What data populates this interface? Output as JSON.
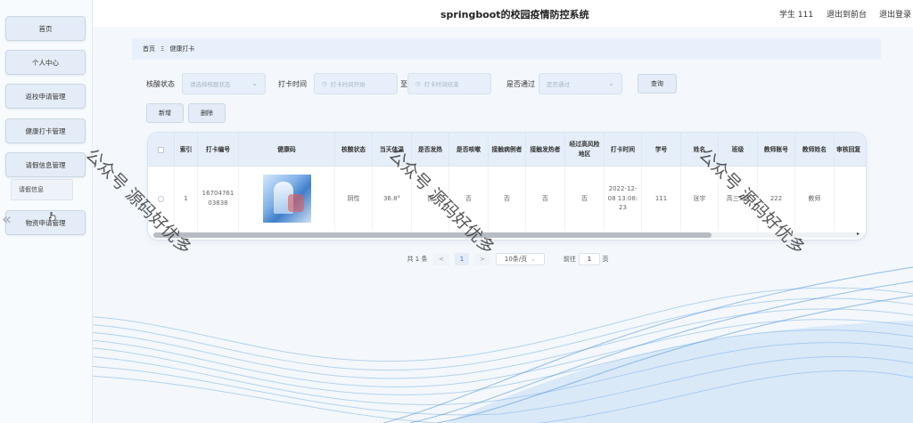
{
  "app": {
    "title": "springboot的校园疫情防控系统"
  },
  "header": {
    "user": "学生 111",
    "back_label": "退出到前台",
    "logout_label": "退出登录"
  },
  "sidebar": {
    "items": [
      {
        "label": "首页"
      },
      {
        "label": "个人中心"
      },
      {
        "label": "返校申请管理"
      },
      {
        "label": "健康打卡管理"
      },
      {
        "label": "请假信息管理"
      },
      {
        "label": "物资申请管理"
      }
    ],
    "submenu_label": "请假信息"
  },
  "breadcrumb": {
    "home": "首页",
    "sep": "Ξ",
    "current": "健康打卡"
  },
  "filters": {
    "status_label": "核酸状态",
    "status_placeholder": "请选择核酸状态",
    "time_label": "打卡时间",
    "time_start_placeholder": "打卡时间开始",
    "time_to": "至",
    "time_end_placeholder": "打卡时间结束",
    "pass_label": "是否通过",
    "pass_placeholder": "是否通过",
    "search_label": "查询",
    "add_label": "新增",
    "delete_label": "删除"
  },
  "table": {
    "headers": [
      "索引",
      "打卡编号",
      "健康码",
      "核酸状态",
      "当天体温",
      "是否发热",
      "是否咳嗽",
      "接触病例者",
      "接触发热者",
      "经过高风险地区",
      "打卡时间",
      "学号",
      "姓名",
      "班级",
      "教师账号",
      "教师姓名",
      "审核回复"
    ],
    "rows": [
      {
        "index": "1",
        "checkin_no": "1670476103838",
        "health_code": "",
        "nucleic": "阴性",
        "temp": "36.8°",
        "fever": "否",
        "cough": "否",
        "contact_case": "否",
        "contact_fever": "否",
        "high_risk": "否",
        "time": "2022-12-08 13:08:23",
        "student_no": "111",
        "name": "张宇",
        "class": "高三5班",
        "teacher_account": "222",
        "teacher_name": "教师",
        "reply": ""
      }
    ]
  },
  "pagination": {
    "total": "共 1 条",
    "prev": "<",
    "current": "1",
    "next": ">",
    "page_size": "10条/页",
    "goto_label": "前往",
    "goto_value": "1",
    "page_unit": "页"
  },
  "watermark": "公众号 源码好优多",
  "icons": {
    "collapse": "chevron-left-icon",
    "arrow": "chevron-down-icon",
    "calendar": "clock-icon"
  },
  "colors": {
    "accent": "#3a76c4",
    "header_bg": "#e6eff9",
    "wave": "#5b9be0"
  }
}
